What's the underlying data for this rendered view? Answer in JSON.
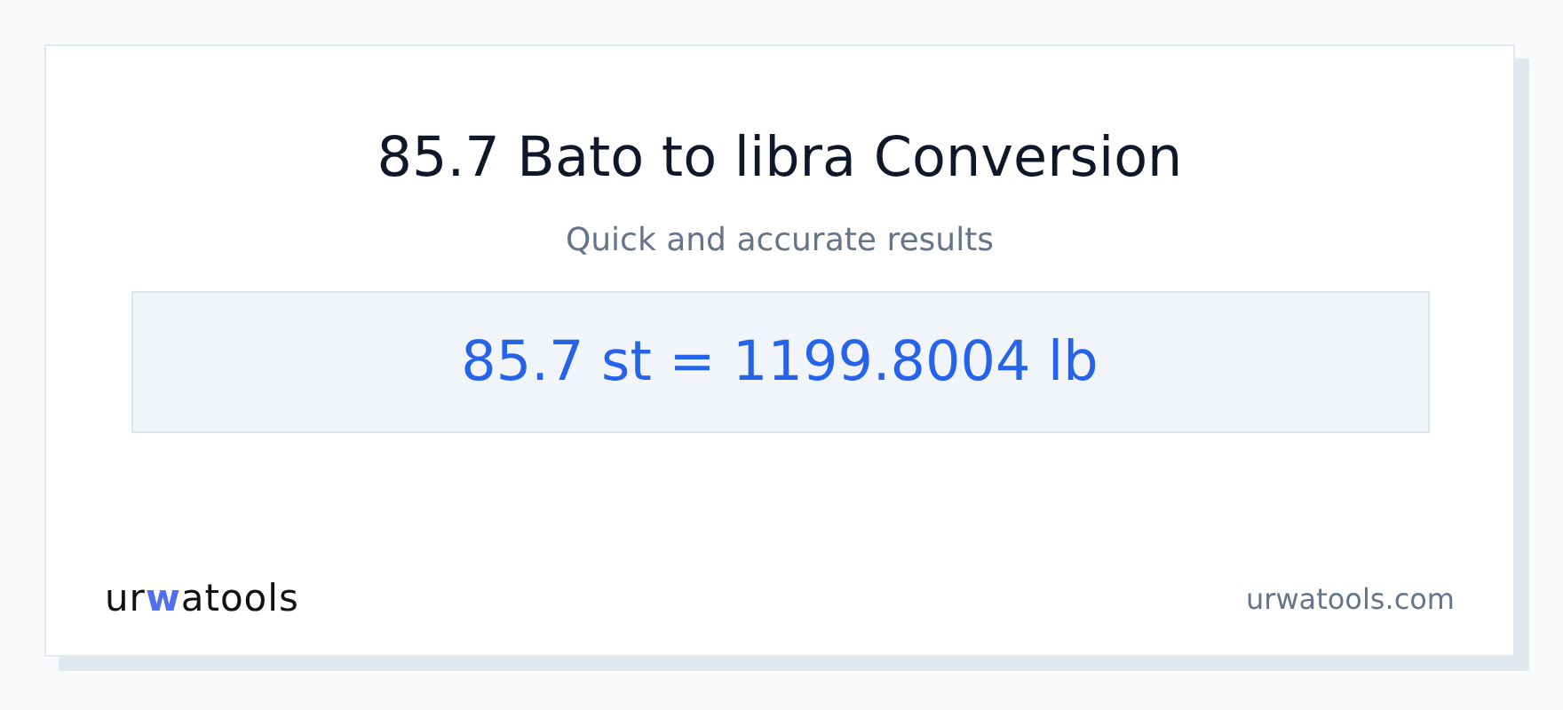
{
  "title": "85.7 Bato to libra Conversion",
  "subtitle": "Quick and accurate results",
  "result": "85.7 st = 1199.8004 lb",
  "logo": [
    {
      "text": "ur",
      "accent": false
    },
    {
      "text": "w",
      "accent": true
    },
    {
      "text": "atools",
      "accent": false
    }
  ],
  "site": "urwatools.com"
}
